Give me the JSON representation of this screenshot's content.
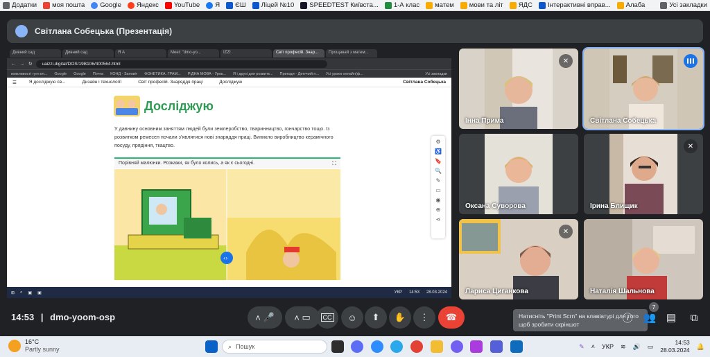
{
  "bookmarks_bar": {
    "items": [
      {
        "label": "Додатки",
        "icon": "apps-icon",
        "color": "#5f6368"
      },
      {
        "label": "моя пошта",
        "icon": "gmail-icon",
        "color": "#ea4335"
      },
      {
        "label": "Google",
        "icon": "google-icon",
        "color": "#4285f4"
      },
      {
        "label": "Яндекс",
        "icon": "yandex-icon",
        "color": "#fc3f1d"
      },
      {
        "label": "YouTube",
        "icon": "youtube-icon",
        "color": "#ff0000"
      },
      {
        "label": "Я",
        "icon": "facebook-icon",
        "color": "#1877f2"
      },
      {
        "label": "ЄШ",
        "icon": "doc-icon",
        "color": "#0b57d0"
      },
      {
        "label": "Ліцей №10",
        "icon": "doc-icon",
        "color": "#0b57d0"
      },
      {
        "label": "SPEEDTEST Київста...",
        "icon": "speedtest-icon",
        "color": "#141526"
      },
      {
        "label": "1-А клас",
        "icon": "classroom-icon",
        "color": "#1e8e3e"
      },
      {
        "label": "матем",
        "icon": "drive-icon",
        "color": "#f9ab00"
      },
      {
        "label": "мови та літ",
        "icon": "drive-icon",
        "color": "#f9ab00"
      },
      {
        "label": "ЯДС",
        "icon": "drive-icon",
        "color": "#f9ab00"
      },
      {
        "label": "Інтерактивні вправ...",
        "icon": "doc-icon",
        "color": "#0b57d0"
      },
      {
        "label": "Алаба",
        "icon": "drive-icon",
        "color": "#f9ab00"
      }
    ],
    "all_bookmarks": "Усі закладки"
  },
  "meet_header": {
    "presenter": "Світлана Собецька (Презентація)"
  },
  "shared_screen": {
    "tabs": [
      "Дивний сад",
      "Дивний сад",
      "Я А",
      "Meet: \"dmo-yo...",
      "IZZI",
      "Світ професій. Знар...",
      "Прощавай з матем..."
    ],
    "url": "uaizzi.digital/DOS/19B106/400564.html",
    "bookmarks": [
      "можливості гугл кл...",
      "Google",
      "Google",
      "Почта",
      "КОНД - Заповіт",
      "ФОНЕТИКА. ГРАМ...",
      "РІДНА МОВА - Урок...",
      "Я і друзі для розвитк...",
      "Пригоди - Дитячий п...",
      "Усі уроки онлайн(ф...",
      "Усі закладки"
    ],
    "nav": [
      "Я досліджую св...",
      "Дизайн і технології",
      "Світ професій. Знаряддя праці",
      "Досліджую"
    ],
    "user": "Світлана Собецька",
    "lesson_title": "Досліджую",
    "paragraph": "У давнину основним заняттям людей були землеробство, тваринництво, гончарство тощо. Із розвитком ремесел почали з’являтися нові знаряддя праці. Виникло виробництво керамічного посуду, прядіння, ткацтво.",
    "task": "Порівняй малюнки. Розкажи, як було колись, а як є сьогодні.",
    "taskbar_lang": "УКР",
    "taskbar_time": "14:53",
    "taskbar_date": "28.03.2024"
  },
  "participants": [
    {
      "name": "Інна Прима",
      "muted": true
    },
    {
      "name": "Світлана Собецька",
      "muted": false,
      "speaking": true
    },
    {
      "name": "Оксана Суворова",
      "muted": false
    },
    {
      "name": "Ірина Блищик",
      "muted": true
    },
    {
      "name": "Лариса Циганкова",
      "muted": true
    },
    {
      "name": "Наталія Шальнова",
      "muted": false
    }
  ],
  "controls": {
    "time": "14:53",
    "meeting_code": "dmo-yoom-osp",
    "toast": "Натисніть \"Print Scrn\" на клавіатурі для того щоб зробити скріншот",
    "participant_count": "7",
    "hangup_color": "#ea4335"
  },
  "windows_taskbar": {
    "temperature": "16°C",
    "weather": "Partly sunny",
    "search_placeholder": "Пошук",
    "lang": "УКР",
    "time": "14:53",
    "date": "28.03.2024",
    "notification_count": "17"
  }
}
